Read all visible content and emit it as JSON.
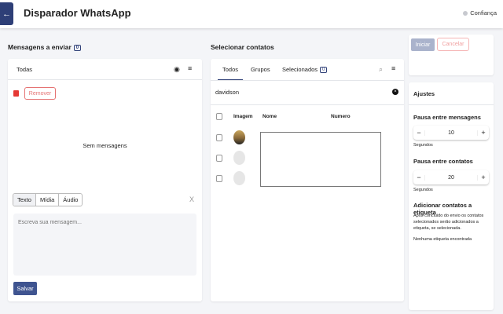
{
  "header": {
    "title": "Disparador WhatsApp",
    "status": "Confiança"
  },
  "messages": {
    "title": "Mensagens a enviar",
    "count": "0",
    "tab": "Todas",
    "remove_label": "Remover",
    "empty": "Sem mensagens",
    "types": [
      "Texto",
      "Mídia",
      "Áudio"
    ],
    "placeholder": "Escreva sua mensagem...",
    "save_label": "Salvar"
  },
  "contacts": {
    "title": "Selecionar contatos",
    "tabs": [
      "Todos",
      "Grupos",
      "Selecionados"
    ],
    "selected_count": "0",
    "search_value": "davidson",
    "columns": [
      "Imagem",
      "Nome",
      "Numero"
    ]
  },
  "actions": {
    "start_label": "Iniciar",
    "cancel_label": "Cancelar"
  },
  "settings": {
    "title": "Ajustes",
    "pause_messages_label": "Pausa entre mensagens",
    "pause_messages_value": "10",
    "pause_contacts_label": "Pausa entre contatos",
    "pause_contacts_value": "20",
    "unit": "Segundos",
    "label_title": "Adicionar contatos a etiqueta",
    "label_desc": "Apos concluido do envio os contatos selecionados serão adicionados a etiqueta, se selecionada.",
    "label_empty": "Nenhuma etiqueta encontrada"
  },
  "colors": {
    "primary": "#2e3f77",
    "danger": "#e53935"
  }
}
